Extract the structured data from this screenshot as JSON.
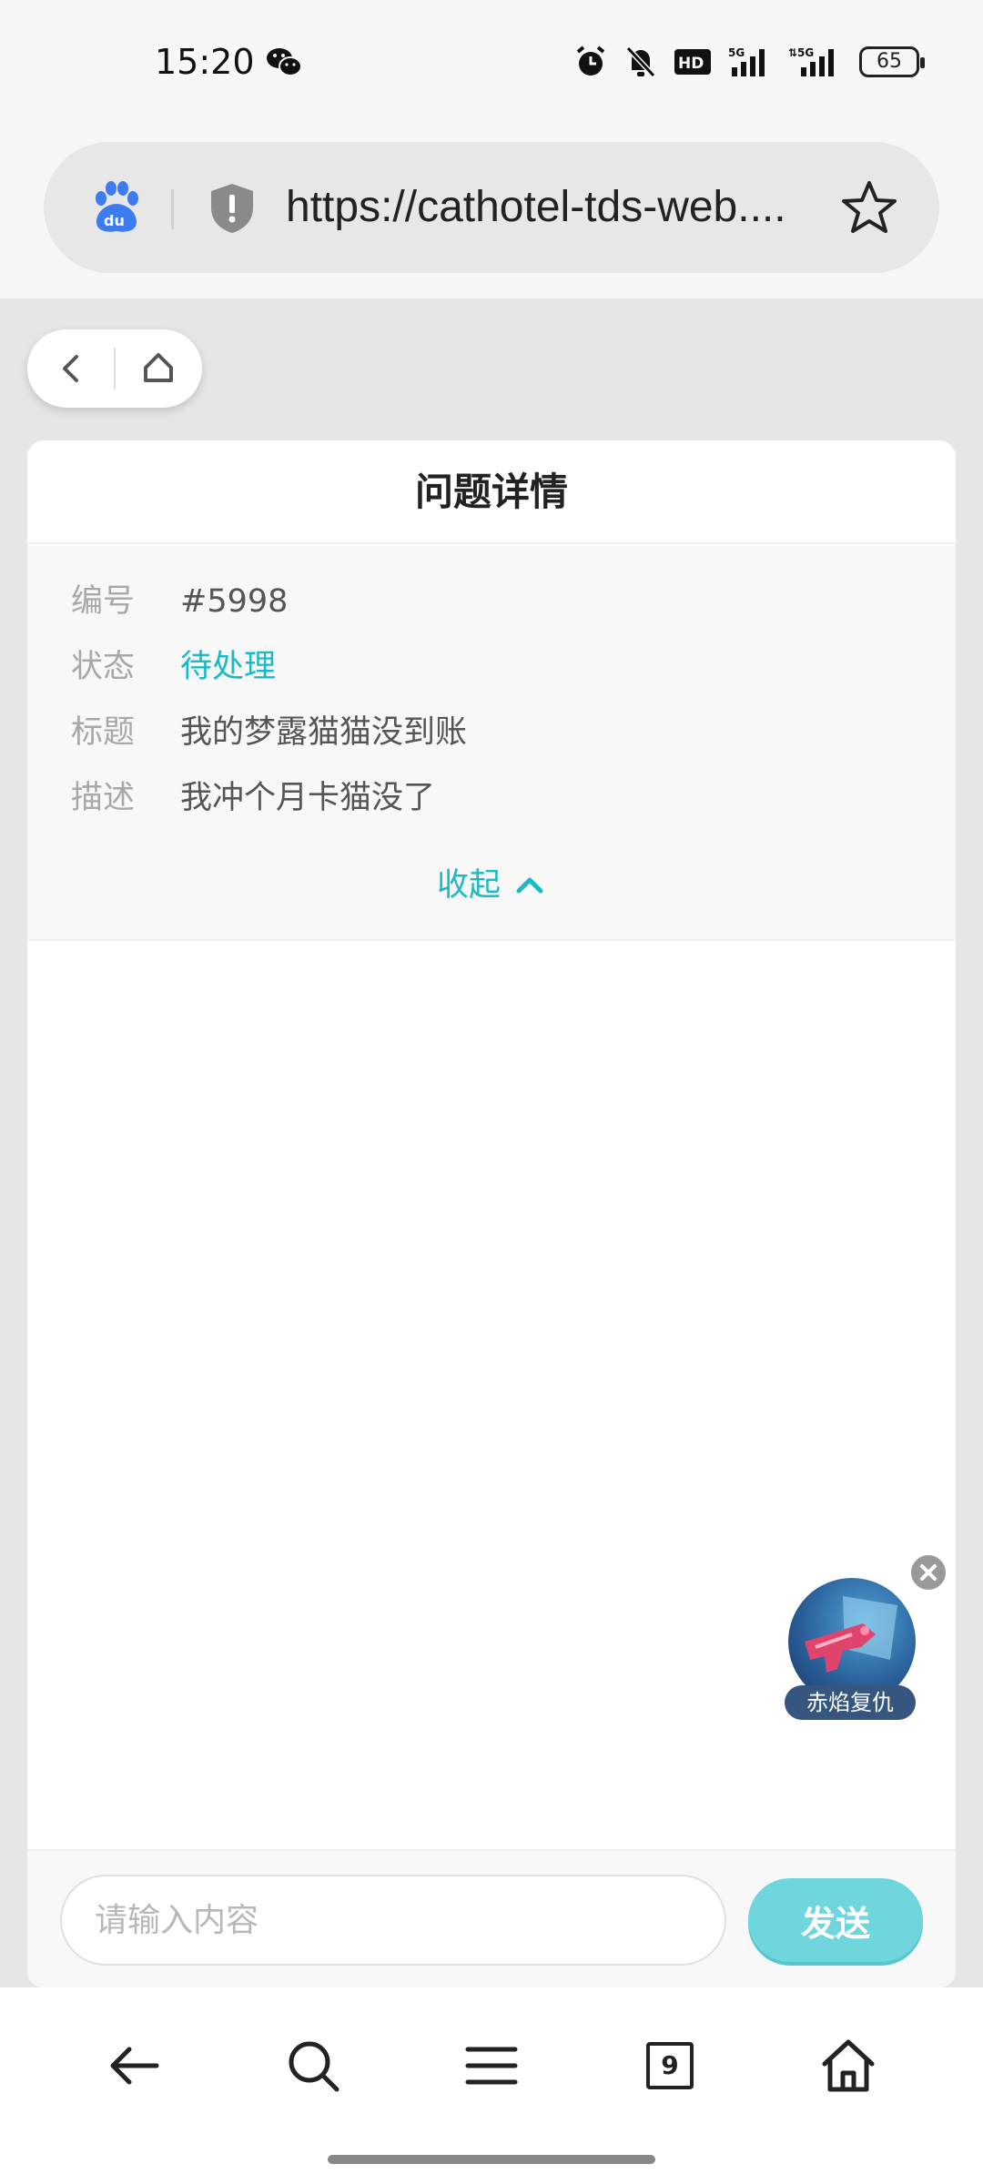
{
  "status_bar": {
    "time": "15:20",
    "battery": "65",
    "icons": [
      "wechat-icon",
      "alarm-icon",
      "mute-bell-icon",
      "hd-icon",
      "signal-5g-icon",
      "signal-5g-icon-2"
    ]
  },
  "browser": {
    "url": "https://cathotel-tds-web....",
    "icons": [
      "baidu-logo",
      "shield-icon",
      "star-icon"
    ]
  },
  "page": {
    "title": "问题详情",
    "fields": [
      {
        "label": "编号",
        "value": "#5998"
      },
      {
        "label": "状态",
        "value": "待处理"
      },
      {
        "label": "标题",
        "value": "我的梦露猫猫没到账"
      },
      {
        "label": "描述",
        "value": "我冲个月卡猫没了"
      }
    ],
    "collapse_label": "收起",
    "input_placeholder": "请输入内容",
    "send_label": "发送",
    "accent_color": "#1cb9c6"
  },
  "float_ad": {
    "label": "赤焰复仇"
  },
  "bottom_nav": {
    "tab_count": "9",
    "items": [
      "back-arrow-icon",
      "search-icon",
      "menu-icon",
      "tabs-icon",
      "home-icon"
    ]
  }
}
